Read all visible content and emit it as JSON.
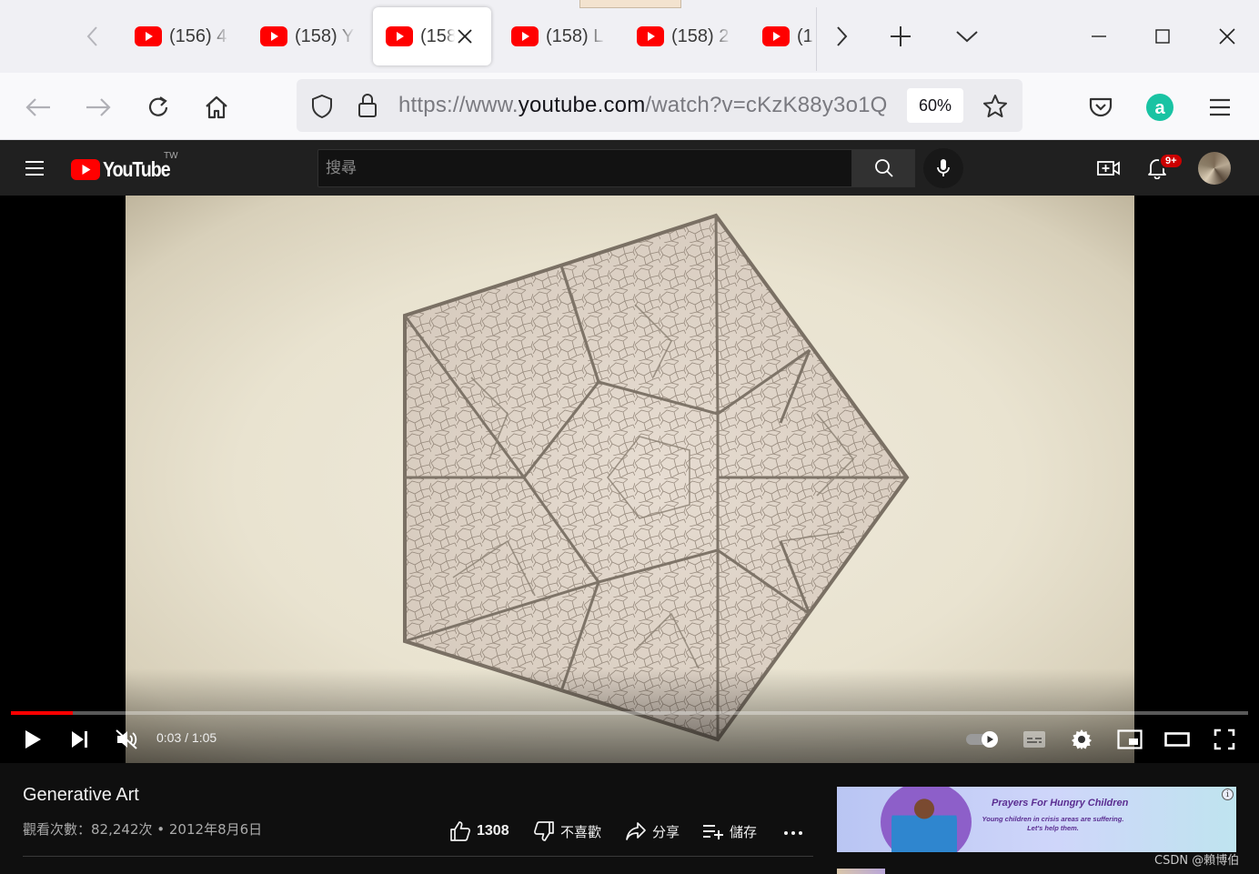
{
  "browser": {
    "tabs": [
      {
        "title": "(156) 4",
        "active": false
      },
      {
        "title": "(158) Y",
        "active": false
      },
      {
        "title": "(158",
        "active": true
      },
      {
        "title": "(158) L",
        "active": false
      },
      {
        "title": "(158) 2",
        "active": false
      },
      {
        "title": "(1",
        "active": false
      }
    ],
    "url_prefix": "https://www.",
    "url_host": "youtube.com",
    "url_path": "/watch?v=cKzK88y3o1Q",
    "zoom": "60%"
  },
  "masthead": {
    "logo_text": "YouTube",
    "country_code": "TW",
    "search_placeholder": "搜尋",
    "notification_badge": "9+"
  },
  "player": {
    "current_time": "0:03",
    "duration": "1:05",
    "time_separator": " / ",
    "progress_fraction": 0.05,
    "muted": true
  },
  "video": {
    "title": "Generative Art",
    "views": "觀看次數：82,242次",
    "date": "2012年8月6日",
    "like_count": "1308",
    "dislike_label": "不喜歡",
    "share_label": "分享",
    "save_label": "儲存"
  },
  "ad": {
    "headline": "Prayers For Hungry Children",
    "body": "Young children in crisis areas are suffering. Let's help them."
  },
  "watermark": "CSDN @賴博伯",
  "colors": {
    "youtube_red": "#ff0000",
    "masthead_bg": "#202020",
    "page_bg": "#0f0f0f"
  }
}
